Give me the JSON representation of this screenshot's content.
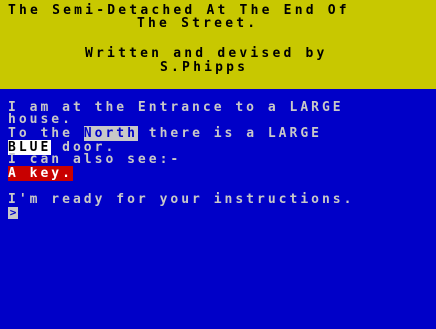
{
  "header": {
    "title_line1": "The Semi-Detached At The End Of",
    "title_line2": "The Street.",
    "credit_line1": "Written and devised by",
    "credit_line2": "S.Phipps"
  },
  "game": {
    "line1": "I am at the Entrance to a LARGE",
    "line2": "house.",
    "line3_pre": "To the ",
    "line3_dir": "North",
    "line3_post": " there is a LARGE",
    "line4_color": "BLUE",
    "line4_post": " door.",
    "line5": "I can also see:-",
    "item": "A key.",
    "ready": "I'm ready for your instructions.",
    "prompt_symbol": ">"
  },
  "colors": {
    "header_bg": "#c8c800",
    "body_bg": "#0000c8",
    "text": "#c8c8c8",
    "item_bg": "#c80000"
  }
}
